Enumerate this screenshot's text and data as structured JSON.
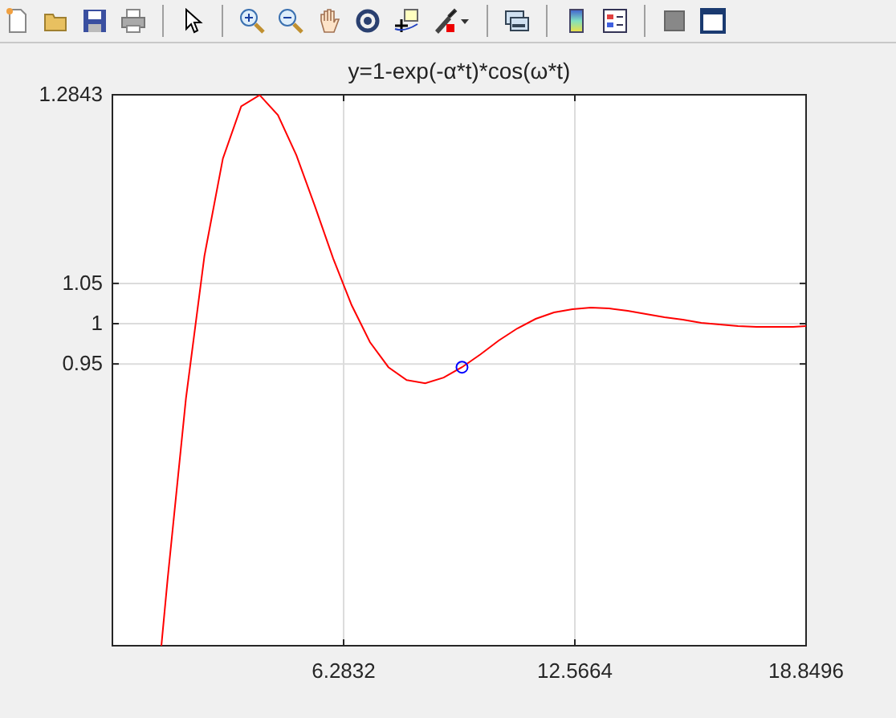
{
  "figure": {
    "chart_data": {
      "type": "line",
      "title": "y=1-exp(-α*t)*cos(ω*t)",
      "x": [
        1.33,
        1.5,
        2,
        2.5,
        3,
        3.5,
        4,
        4.5,
        5,
        5.5,
        6,
        6.5,
        7,
        7.5,
        8,
        8.5,
        9,
        9.5,
        10,
        10.5,
        11,
        11.5,
        12,
        12.5,
        13,
        13.5,
        14,
        14.5,
        15,
        15.5,
        16,
        16.5,
        17,
        17.5,
        18,
        18.5,
        18.8496
      ],
      "grid": true,
      "series": [
        {
          "color": "#ff0000",
          "values": [
            0.6,
            0.683,
            0.907,
            1.084,
            1.205,
            1.27,
            1.284,
            1.259,
            1.209,
            1.146,
            1.081,
            1.023,
            0.977,
            0.946,
            0.93,
            0.926,
            0.933,
            0.946,
            0.962,
            0.979,
            0.994,
            1.006,
            1.014,
            1.018,
            1.02,
            1.019,
            1.016,
            1.012,
            1.008,
            1.005,
            1.001,
            0.999,
            0.997,
            0.996,
            0.996,
            0.996,
            0.997
          ]
        },
        {
          "color": "#0000ff",
          "marker": "o",
          "values": [
            null,
            null,
            null,
            null,
            null,
            null,
            null,
            null,
            null,
            null,
            null,
            null,
            null,
            null,
            null,
            null,
            null,
            0.946,
            null,
            null,
            null,
            null,
            null,
            null,
            null,
            null,
            null,
            null,
            null,
            null,
            null,
            null,
            null,
            null,
            null,
            null,
            null
          ]
        }
      ],
      "xlim": [
        0,
        18.8496
      ],
      "ylim": [
        0.6,
        1.2843
      ],
      "xticks": [
        6.2832,
        12.5664,
        18.8496
      ],
      "yticks": [
        0.95,
        1,
        1.05,
        1.2843
      ]
    }
  }
}
